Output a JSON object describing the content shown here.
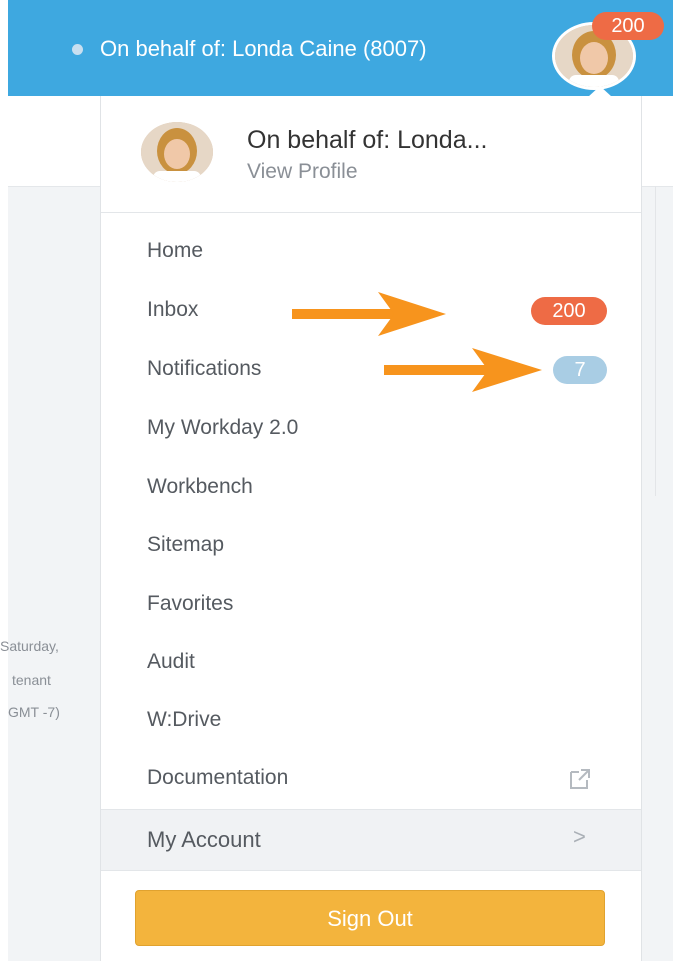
{
  "header": {
    "behalf_text": "On behalf of: Londa Caine (8007)",
    "badge_count": "200"
  },
  "profile": {
    "name": "On behalf of: Londa...",
    "view_profile": "View Profile"
  },
  "menu": {
    "items": [
      {
        "label": "Home"
      },
      {
        "label": "Inbox",
        "badge": "200"
      },
      {
        "label": "Notifications",
        "badge": "7"
      },
      {
        "label": "My Workday 2.0"
      },
      {
        "label": "Workbench"
      },
      {
        "label": "Sitemap"
      },
      {
        "label": "Favorites"
      },
      {
        "label": "Audit"
      },
      {
        "label": "W:Drive"
      },
      {
        "label": "Documentation",
        "icon": "external-link-icon"
      }
    ],
    "my_account": "My Account",
    "sign_out": "Sign Out"
  },
  "background_text": {
    "line1": "Saturday,",
    "line2": "tenant",
    "line3": "GMT -7)"
  },
  "colors": {
    "header_bg": "#3ea8e0",
    "badge_red": "#ee6b45",
    "badge_blue": "#a9cde4",
    "sign_out_bg": "#f3b43d",
    "arrow": "#f7941d"
  }
}
